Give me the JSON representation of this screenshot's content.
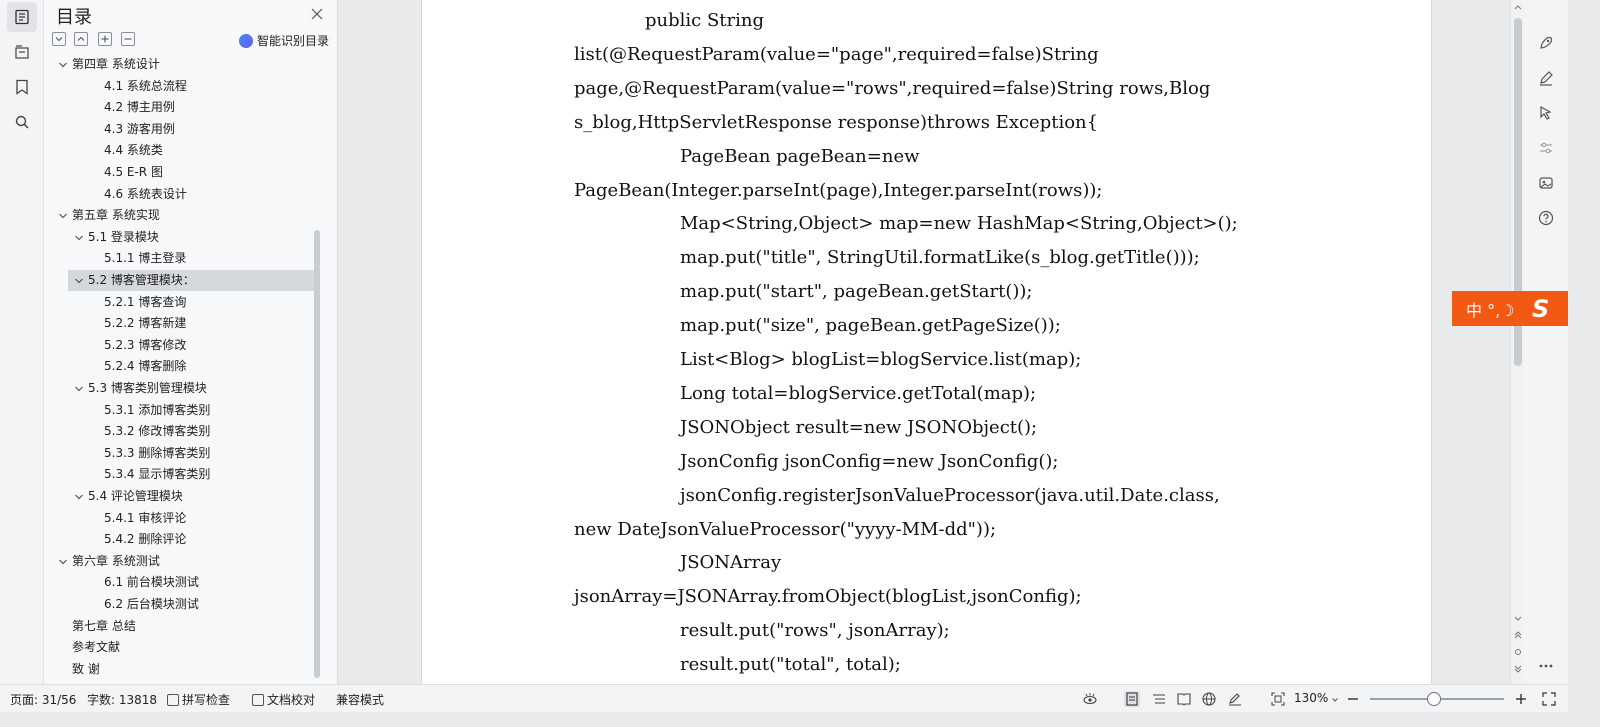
{
  "toc": {
    "title": "目录",
    "smart_label": "智能识别目录",
    "items": [
      {
        "label": "第四章   系统设计",
        "level": 0,
        "arrow": "down"
      },
      {
        "label": "4.1  系统总流程",
        "level": 2,
        "arrow": ""
      },
      {
        "label": "4.2  博主用例",
        "level": 2,
        "arrow": ""
      },
      {
        "label": "4.3  游客用例",
        "level": 2,
        "arrow": ""
      },
      {
        "label": "4.4  系统类",
        "level": 2,
        "arrow": ""
      },
      {
        "label": "4.5 E-R 图",
        "level": 2,
        "arrow": ""
      },
      {
        "label": "4.6  系统表设计",
        "level": 2,
        "arrow": ""
      },
      {
        "label": "第五章   系统实现",
        "level": 0,
        "arrow": "down"
      },
      {
        "label": "5.1  登录模块",
        "level": 1,
        "arrow": "down"
      },
      {
        "label": "5.1.1  博主登录",
        "level": 2,
        "arrow": ""
      },
      {
        "label": "5.2  博客管理模块：",
        "level": 1,
        "arrow": "down",
        "selected": true
      },
      {
        "label": "5.2.1  博客查询",
        "level": 2,
        "arrow": ""
      },
      {
        "label": "5.2.2  博客新建",
        "level": 2,
        "arrow": ""
      },
      {
        "label": "5.2.3  博客修改",
        "level": 2,
        "arrow": ""
      },
      {
        "label": "5.2.4  博客删除",
        "level": 2,
        "arrow": ""
      },
      {
        "label": "5.3  博客类别管理模块",
        "level": 1,
        "arrow": "down"
      },
      {
        "label": "5.3.1  添加博客类别",
        "level": 2,
        "arrow": ""
      },
      {
        "label": "5.3.2  修改博客类别",
        "level": 2,
        "arrow": ""
      },
      {
        "label": "5.3.3  删除博客类别",
        "level": 2,
        "arrow": ""
      },
      {
        "label": "5.3.4  显示博客类别",
        "level": 2,
        "arrow": ""
      },
      {
        "label": "5.4  评论管理模块",
        "level": 1,
        "arrow": "down"
      },
      {
        "label": "5.4.1  审核评论",
        "level": 2,
        "arrow": ""
      },
      {
        "label": "5.4.2  删除评论",
        "level": 2,
        "arrow": ""
      },
      {
        "label": "第六章   系统测试",
        "level": 0,
        "arrow": "down"
      },
      {
        "label": "6.1  前台模块测试",
        "level": 2,
        "arrow": ""
      },
      {
        "label": "6.2  后台模块测试",
        "level": 2,
        "arrow": ""
      },
      {
        "label": "第七章  总结",
        "level": 0,
        "arrow": ""
      },
      {
        "label": "参考文献",
        "level": 0,
        "arrow": ""
      },
      {
        "label": "致   谢",
        "level": 0,
        "arrow": ""
      }
    ]
  },
  "code_lines": [
    {
      "text": "public String",
      "indent": 2
    },
    {
      "text": "list(@RequestParam(value=\"page\",required=false)String",
      "indent": 0
    },
    {
      "text": "page,@RequestParam(value=\"rows\",required=false)String rows,Blog",
      "indent": 0
    },
    {
      "text": "s_blog,HttpServletResponse response)throws Exception{",
      "indent": 0
    },
    {
      "text": "PageBean pageBean=new",
      "indent": 3
    },
    {
      "text": "PageBean(Integer.parseInt(page),Integer.parseInt(rows));",
      "indent": 0
    },
    {
      "text": "Map<String,Object> map=new HashMap<String,Object>();",
      "indent": 3
    },
    {
      "text": "map.put(\"title\", StringUtil.formatLike(s_blog.getTitle()));",
      "indent": 3
    },
    {
      "text": "map.put(\"start\", pageBean.getStart());",
      "indent": 3
    },
    {
      "text": "map.put(\"size\", pageBean.getPageSize());",
      "indent": 3
    },
    {
      "text": "List<Blog> blogList=blogService.list(map);",
      "indent": 3
    },
    {
      "text": "Long total=blogService.getTotal(map);",
      "indent": 3
    },
    {
      "text": "JSONObject result=new JSONObject();",
      "indent": 3
    },
    {
      "text": "JsonConfig jsonConfig=new JsonConfig();",
      "indent": 3
    },
    {
      "text": "jsonConfig.registerJsonValueProcessor(java.util.Date.class,",
      "indent": 3
    },
    {
      "text": "new DateJsonValueProcessor(\"yyyy-MM-dd\"));",
      "indent": 0
    },
    {
      "text": "JSONArray",
      "indent": 3
    },
    {
      "text": "jsonArray=JSONArray.fromObject(blogList,jsonConfig);",
      "indent": 0
    },
    {
      "text": "result.put(\"rows\", jsonArray);",
      "indent": 3
    },
    {
      "text": "result.put(\"total\", total);",
      "indent": 3
    }
  ],
  "ime": {
    "label": "中 °,☽"
  },
  "status": {
    "page": "页面: 31/56",
    "words": "字数: 13818",
    "spell": "拼写检查",
    "proof": "文档校对",
    "compat": "兼容模式",
    "zoom": "130%",
    "zoom_level": 0.48
  },
  "colors": {
    "ime": "#f25a13",
    "selected": "#d5d8dd",
    "squiggle": "#e0403a"
  }
}
